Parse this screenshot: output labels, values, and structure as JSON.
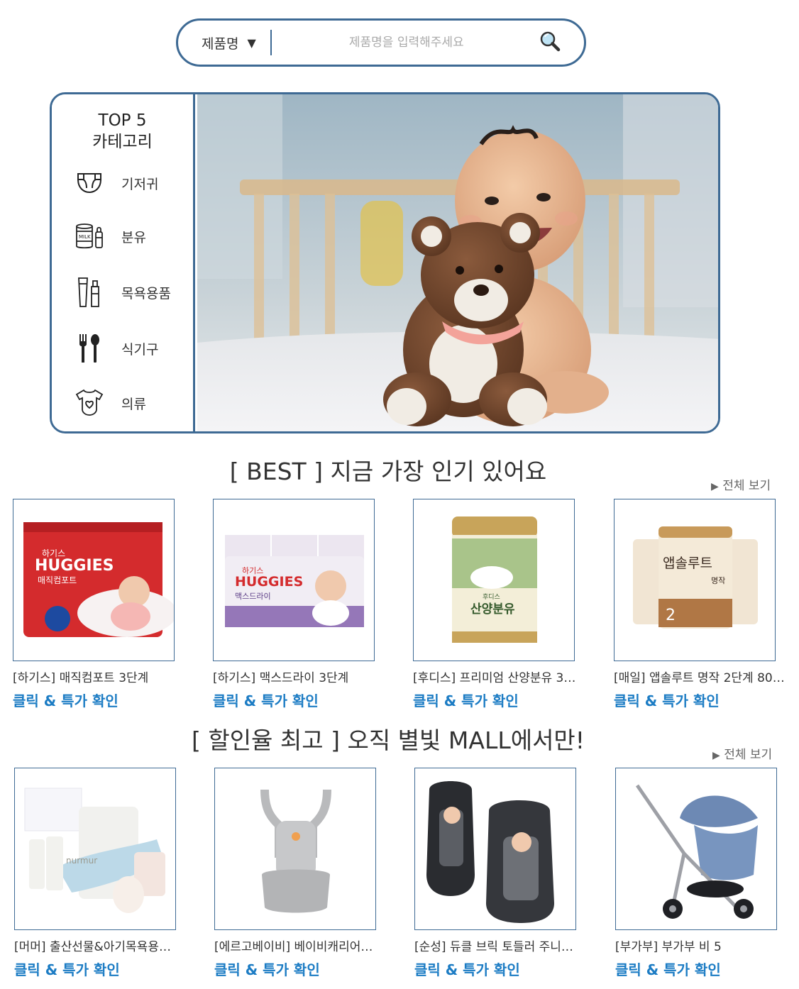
{
  "search": {
    "category": "제품명",
    "placeholder": "제품명을 입력해주세요"
  },
  "hero": {
    "title_line1": "TOP 5",
    "title_line2": "카테고리",
    "categories": [
      {
        "label": "기저귀",
        "icon": "diaper-icon"
      },
      {
        "label": "분유",
        "icon": "formula-milk-icon"
      },
      {
        "label": "목욕용품",
        "icon": "bath-products-icon"
      },
      {
        "label": "식기구",
        "icon": "tableware-icon"
      },
      {
        "label": "의류",
        "icon": "onesie-icon"
      }
    ]
  },
  "best": {
    "title": "[ BEST ] 지금 가장 인기 있어요",
    "view_all": "전체 보기",
    "products": [
      {
        "name": "[하기스] 매직컴포트 3단계",
        "cta": "클릭 & 특가 확인"
      },
      {
        "name": "[하기스] 맥스드라이 3단계",
        "cta": "클릭 & 특가 확인"
      },
      {
        "name": "[후디스] 프리미엄 산양분유 3…",
        "cta": "클릭 & 특가 확인"
      },
      {
        "name": "[매일] 앱솔루트 명작 2단계 80…",
        "cta": "클릭 & 특가 확인"
      }
    ],
    "packaging": {
      "huggies": "HUGGIES",
      "huggies_ko": "하기스",
      "magic_comfort": "매직컴포트",
      "max_dry": "맥스드라이",
      "formula_brand": "후디스",
      "goat_formula": "산양분유",
      "absolute": "앱솔루트",
      "masterpiece": "명작"
    }
  },
  "discount": {
    "title": "[ 할인율 최고 ] 오직 별빛 MALL에서만!",
    "view_all": "전체 보기",
    "products": [
      {
        "name": "[머머] 출산선물&아기목욕용…",
        "cta": "클릭 & 특가 확인"
      },
      {
        "name": "[에르고베이비] 베이비캐리어…",
        "cta": "클릭 & 특가 확인"
      },
      {
        "name": "[순성] 듀클 브릭 토들러 주니…",
        "cta": "클릭 & 특가 확인"
      },
      {
        "name": "[부가부] 부가부 비 5",
        "cta": "클릭 & 특가 확인"
      }
    ],
    "packaging": {
      "nurmur": "nurmur"
    }
  },
  "colors": {
    "accent": "#3e6a94",
    "link": "#1c7cc4"
  }
}
